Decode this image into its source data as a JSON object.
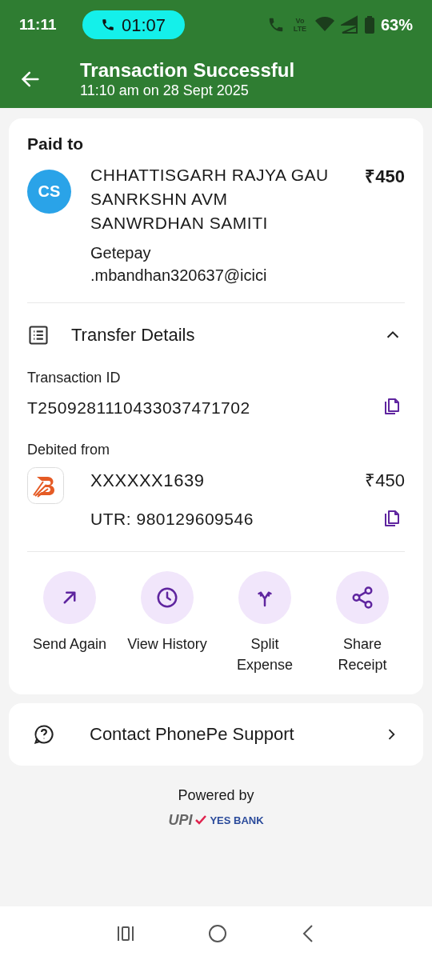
{
  "status_bar": {
    "time": "11:11",
    "call_timer": "01:07",
    "volte": "Vo LTE",
    "battery": "63%"
  },
  "header": {
    "title": "Transaction Successful",
    "subtitle": "11:10 am on 28 Sept 2025"
  },
  "paid_to": {
    "label": "Paid to",
    "avatar": "CS",
    "name": "CHHATTISGARH RAJYA GAU SANRKSHN AVM SANWRDHAN SAMITI",
    "upi_id": "Getepay\n.mbandhan320637@icici",
    "amount": "₹450"
  },
  "transfer_details": {
    "title": "Transfer Details",
    "expanded": true,
    "transaction_id_label": "Transaction ID",
    "transaction_id": "T2509281110433037471702",
    "debited_from_label": "Debited from",
    "account": "XXXXXX1639",
    "debit_amount": "₹450",
    "utr": "UTR: 980129609546"
  },
  "actions": [
    {
      "kind": "send",
      "label": "Send Again"
    },
    {
      "kind": "history",
      "label": "View History"
    },
    {
      "kind": "split",
      "label": "Split Expense"
    },
    {
      "kind": "share",
      "label": "Share Receipt"
    }
  ],
  "support": {
    "label": "Contact PhonePe Support"
  },
  "footer": {
    "powered_by": "Powered by",
    "upi": "UPI",
    "bank": "YES BANK"
  }
}
